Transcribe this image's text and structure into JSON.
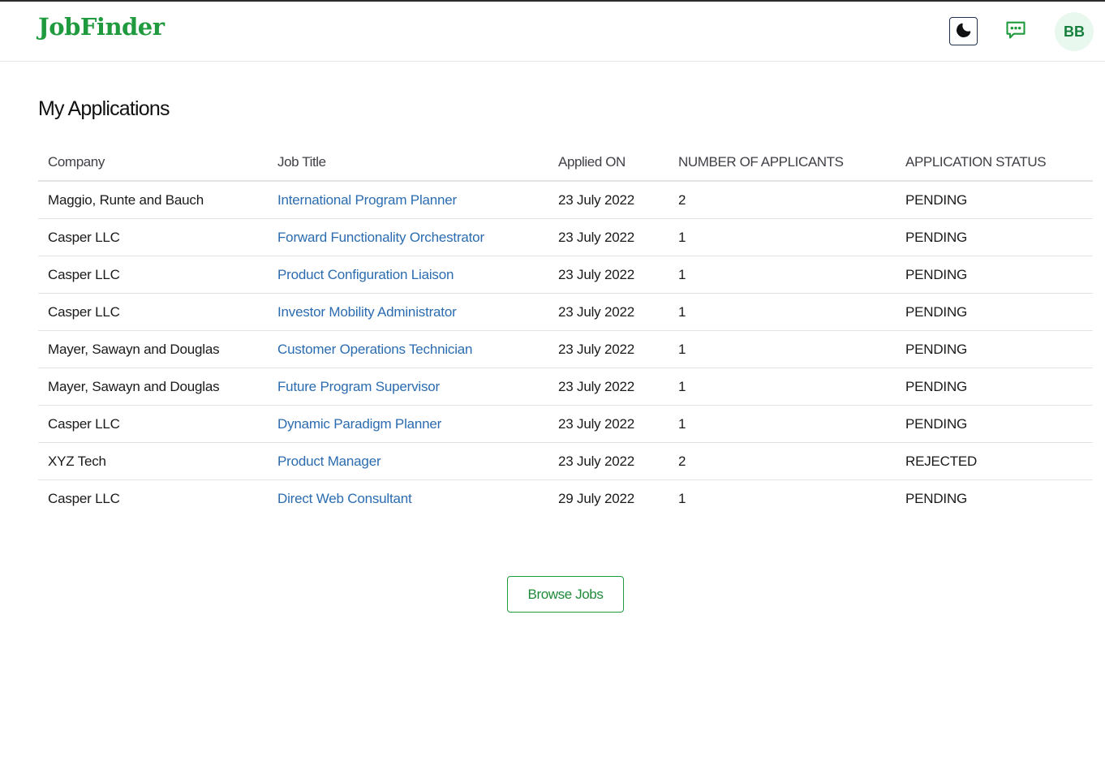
{
  "app": {
    "logo": "JobFinder"
  },
  "header": {
    "theme_toggle_icon": "moon-icon",
    "messages_icon": "chat-bubble-icon",
    "avatar_initials": "BB",
    "accent_color": "#1f9a3e"
  },
  "page": {
    "title": "My Applications"
  },
  "table": {
    "headers": [
      "Company",
      "Job Title",
      "Applied ON",
      "NUMBER OF APPLICANTS",
      "APPLICATION STATUS"
    ],
    "rows": [
      {
        "company": "Maggio, Runte and Bauch",
        "job_title": "International Program Planner",
        "applied_on": "23 July 2022",
        "applicants": "2",
        "status": "PENDING"
      },
      {
        "company": "Casper LLC",
        "job_title": "Forward Functionality Orchestrator",
        "applied_on": "23 July 2022",
        "applicants": "1",
        "status": "PENDING"
      },
      {
        "company": "Casper LLC",
        "job_title": "Product Configuration Liaison",
        "applied_on": "23 July 2022",
        "applicants": "1",
        "status": "PENDING"
      },
      {
        "company": "Casper LLC",
        "job_title": "Investor Mobility Administrator",
        "applied_on": "23 July 2022",
        "applicants": "1",
        "status": "PENDING"
      },
      {
        "company": "Mayer, Sawayn and Douglas",
        "job_title": "Customer Operations Technician",
        "applied_on": "23 July 2022",
        "applicants": "1",
        "status": "PENDING"
      },
      {
        "company": "Mayer, Sawayn and Douglas",
        "job_title": "Future Program Supervisor",
        "applied_on": "23 July 2022",
        "applicants": "1",
        "status": "PENDING"
      },
      {
        "company": "Casper LLC",
        "job_title": "Dynamic Paradigm Planner",
        "applied_on": "23 July 2022",
        "applicants": "1",
        "status": "PENDING"
      },
      {
        "company": "XYZ Tech",
        "job_title": "Product Manager",
        "applied_on": "23 July 2022",
        "applicants": "2",
        "status": "REJECTED"
      },
      {
        "company": "Casper LLC",
        "job_title": "Direct Web Consultant",
        "applied_on": "29 July 2022",
        "applicants": "1",
        "status": "PENDING"
      }
    ]
  },
  "actions": {
    "browse_jobs_label": "Browse Jobs"
  }
}
